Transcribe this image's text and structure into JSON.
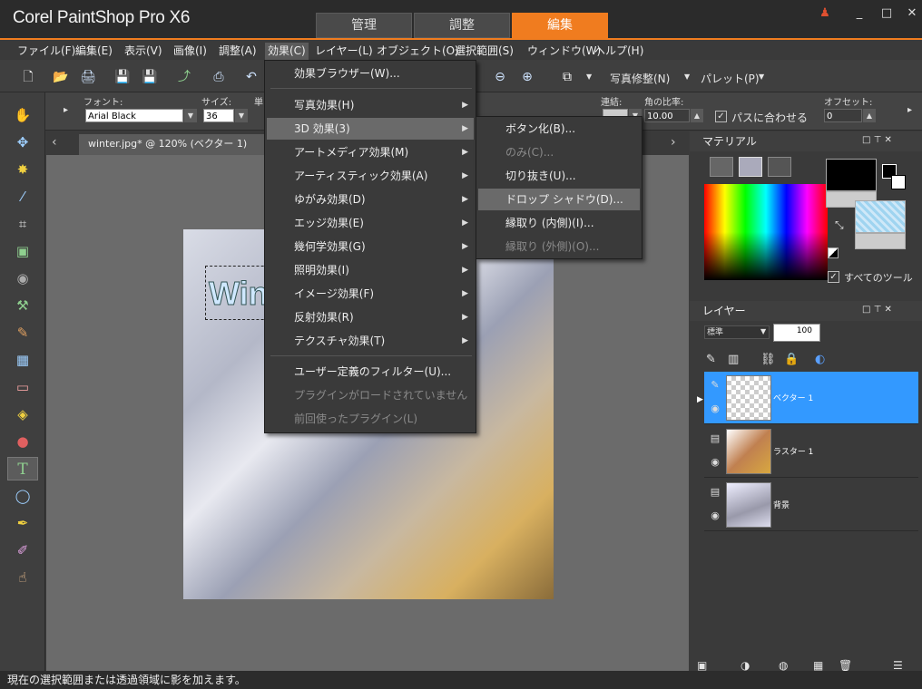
{
  "app": {
    "title": "Corel PaintShop Pro X6"
  },
  "mode_tabs": [
    "管理",
    "調整",
    "編集"
  ],
  "window_controls": {
    "user": "user-icon",
    "min": "_",
    "max": "□",
    "close": "✕"
  },
  "menubar": [
    "ファイル(F)",
    "編集(E)",
    "表示(V)",
    "画像(I)",
    "調整(A)",
    "効果(C)",
    "レイヤー(L)",
    "オブジェクト(O)",
    "選択範囲(S)",
    "ウィンドウ(W)",
    "ヘルプ(H)"
  ],
  "toolbar": {
    "photo_fix": "写真修整(N)",
    "palette": "パレット(P)"
  },
  "text_options": {
    "font_label": "フォント:",
    "font_value": "Arial Black",
    "size_label": "サイズ:",
    "size_value": "36",
    "unit_label": "単",
    "link_label": "連結:",
    "angle_label": "角の比率:",
    "angle_value": "10.00",
    "fit_path": "パスに合わせる",
    "offset_label": "オフセット:",
    "offset_value": "0"
  },
  "document": {
    "tab": "winter.jpg* @ 120% (ベクター 1)",
    "canvas_text": "Win"
  },
  "effects_menu": [
    {
      "label": "効果ブラウザー(W)...",
      "arrow": false,
      "disabled": false
    },
    {
      "label": "写真効果(H)",
      "arrow": true,
      "disabled": false
    },
    {
      "label": "3D 効果(3)",
      "arrow": true,
      "disabled": false
    },
    {
      "label": "アートメディア効果(M)",
      "arrow": true,
      "disabled": false
    },
    {
      "label": "アーティスティック効果(A)",
      "arrow": true,
      "disabled": false
    },
    {
      "label": "ゆがみ効果(D)",
      "arrow": true,
      "disabled": false
    },
    {
      "label": "エッジ効果(E)",
      "arrow": true,
      "disabled": false
    },
    {
      "label": "幾何学効果(G)",
      "arrow": true,
      "disabled": false
    },
    {
      "label": "照明効果(I)",
      "arrow": true,
      "disabled": false
    },
    {
      "label": "イメージ効果(F)",
      "arrow": true,
      "disabled": false
    },
    {
      "label": "反射効果(R)",
      "arrow": true,
      "disabled": false
    },
    {
      "label": "テクスチャ効果(T)",
      "arrow": true,
      "disabled": false
    },
    {
      "label": "ユーザー定義のフィルター(U)...",
      "arrow": false,
      "disabled": false
    },
    {
      "label": "プラグインがロードされていません",
      "arrow": false,
      "disabled": true
    },
    {
      "label": "前回使ったプラグイン(L)",
      "arrow": false,
      "disabled": true
    }
  ],
  "submenu_3d": [
    {
      "label": "ボタン化(B)...",
      "disabled": false
    },
    {
      "label": "のみ(C)...",
      "disabled": true
    },
    {
      "label": "切り抜き(U)...",
      "disabled": false
    },
    {
      "label": "ドロップ シャドウ(D)...",
      "disabled": false
    },
    {
      "label": "縁取り (内側)(I)...",
      "disabled": false
    },
    {
      "label": "縁取り (外側)(O)...",
      "disabled": true
    }
  ],
  "materials": {
    "title": "マテリアル",
    "all_tools": "すべてのツール"
  },
  "layers": {
    "title": "レイヤー",
    "blend_mode": "標準",
    "opacity": "100",
    "items": [
      {
        "name": "ベクター 1"
      },
      {
        "name": "ラスター 1"
      },
      {
        "name": "背景"
      }
    ]
  },
  "statusbar": {
    "text": "現在の選択範囲または透過領域に影を加えます。"
  }
}
